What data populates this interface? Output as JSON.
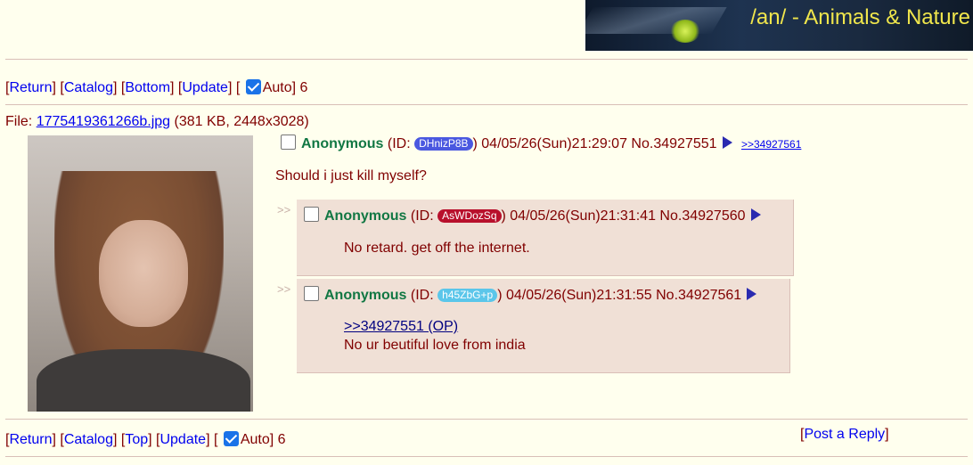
{
  "banner": {
    "title": "/an/ - Animals & Nature"
  },
  "nav_top": {
    "return": "Return",
    "catalog": "Catalog",
    "bottom": "Bottom",
    "update": "Update",
    "auto": "Auto",
    "count": "6"
  },
  "file": {
    "label": "File:",
    "name": "1775419361266b.jpg",
    "meta": "(381 KB, 2448x3028)"
  },
  "op": {
    "name": "Anonymous",
    "id_prefix": "(ID:",
    "id": "DHnizP8B",
    "id_color": "#4a58e0",
    "datetime": ") 04/05/26(Sun)21:29:07",
    "number": "No.34927551",
    "backlink": ">>34927561",
    "message": "Should i just kill myself?"
  },
  "replies": [
    {
      "side": ">>",
      "name": "Anonymous",
      "id_prefix": "(ID:",
      "id": "AsWDozSq",
      "id_color": "#b8102c",
      "datetime": ") 04/05/26(Sun)21:31:41",
      "number": "No.34927560",
      "message": "No retard. get off the internet."
    },
    {
      "side": ">>",
      "name": "Anonymous",
      "id_prefix": "(ID:",
      "id": "h45ZbG+p",
      "id_color": "#5bc6ea",
      "datetime": ") 04/05/26(Sun)21:31:55",
      "number": "No.34927561",
      "quote": ">>34927551 (OP)",
      "message": "No ur beutiful love from india"
    }
  ],
  "nav_bottom": {
    "return": "Return",
    "catalog": "Catalog",
    "top": "Top",
    "update": "Update",
    "auto": "Auto",
    "count": "6"
  },
  "post_reply": "Post a Reply"
}
